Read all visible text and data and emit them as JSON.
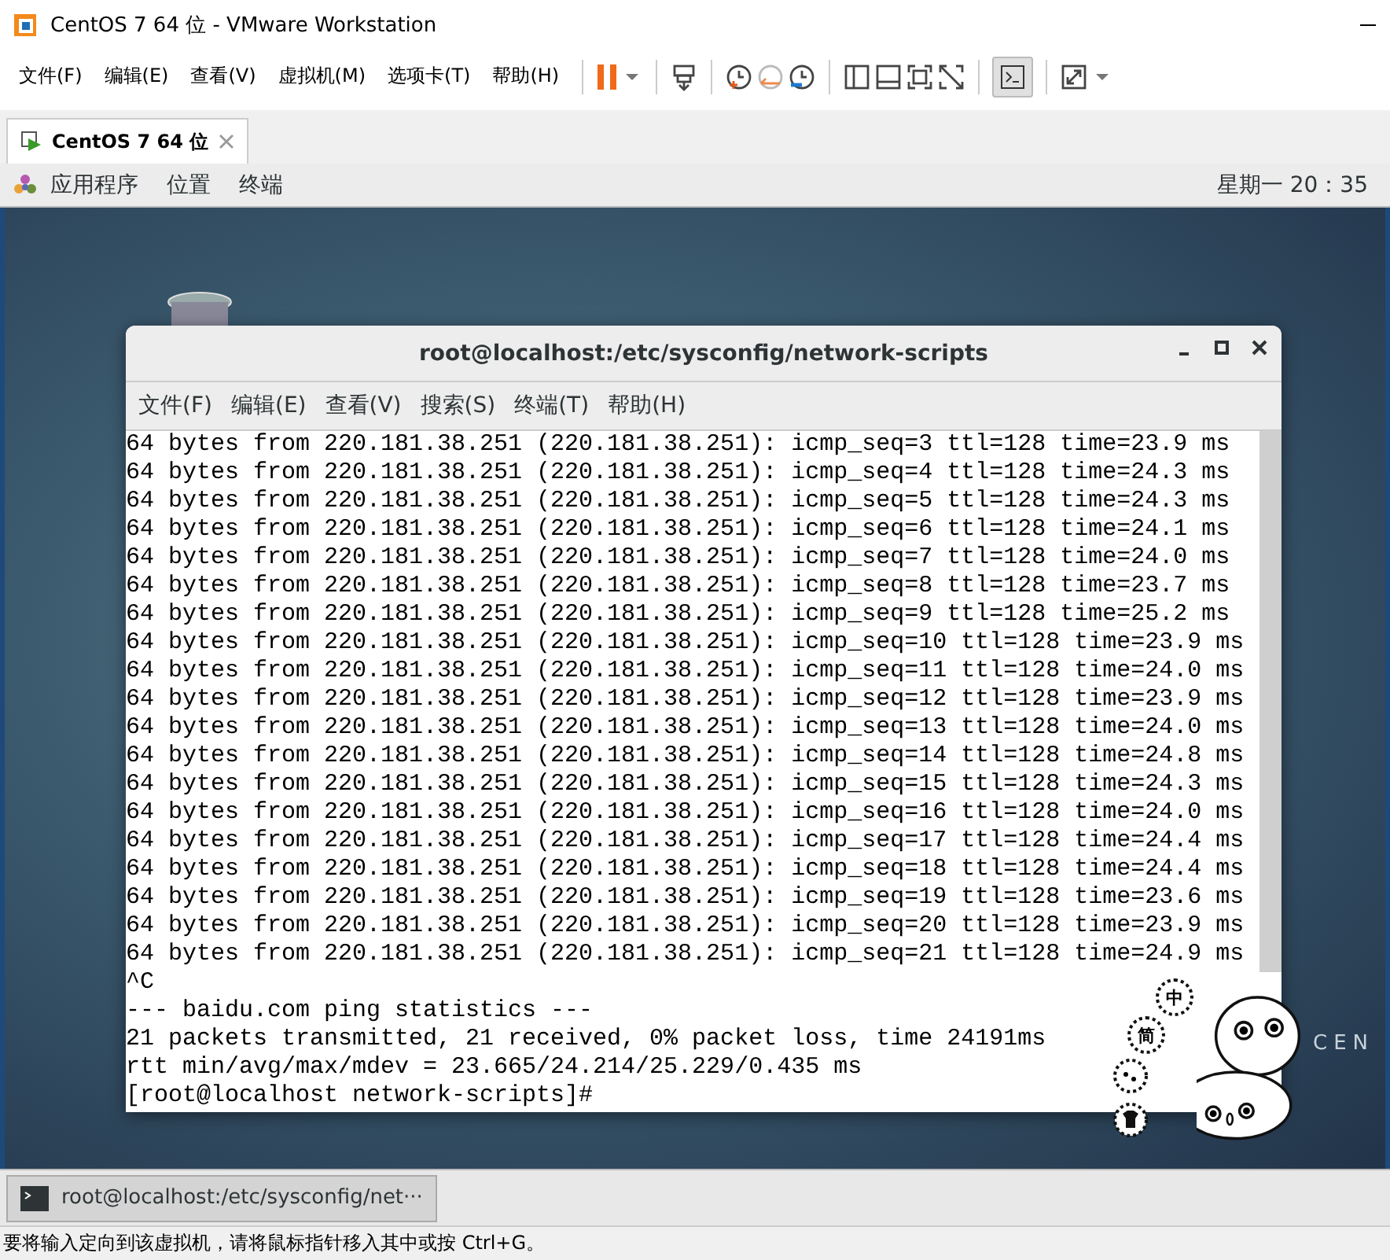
{
  "window": {
    "title": "CentOS 7 64 位 - VMware Workstation"
  },
  "menu": [
    "文件(F)",
    "编辑(E)",
    "查看(V)",
    "虚拟机(M)",
    "选项卡(T)",
    "帮助(H)"
  ],
  "tabs": [
    {
      "label": "CentOS 7 64 位",
      "selected": true
    }
  ],
  "gnome_bar": {
    "items": [
      "应用程序",
      "位置",
      "终端"
    ],
    "clock": "星期一 20：35"
  },
  "desktop": {
    "logo_text": "CEN"
  },
  "terminal": {
    "title": "root@localhost:/etc/sysconfig/network-scripts",
    "menu": [
      "文件(F)",
      "编辑(E)",
      "查看(V)",
      "搜索(S)",
      "终端(T)",
      "帮助(H)"
    ],
    "lines": [
      "64 bytes from 220.181.38.251 (220.181.38.251): icmp_seq=3 ttl=128 time=23.9 ms",
      "64 bytes from 220.181.38.251 (220.181.38.251): icmp_seq=4 ttl=128 time=24.3 ms",
      "64 bytes from 220.181.38.251 (220.181.38.251): icmp_seq=5 ttl=128 time=24.3 ms",
      "64 bytes from 220.181.38.251 (220.181.38.251): icmp_seq=6 ttl=128 time=24.1 ms",
      "64 bytes from 220.181.38.251 (220.181.38.251): icmp_seq=7 ttl=128 time=24.0 ms",
      "64 bytes from 220.181.38.251 (220.181.38.251): icmp_seq=8 ttl=128 time=23.7 ms",
      "64 bytes from 220.181.38.251 (220.181.38.251): icmp_seq=9 ttl=128 time=25.2 ms",
      "64 bytes from 220.181.38.251 (220.181.38.251): icmp_seq=10 ttl=128 time=23.9 ms",
      "64 bytes from 220.181.38.251 (220.181.38.251): icmp_seq=11 ttl=128 time=24.0 ms",
      "64 bytes from 220.181.38.251 (220.181.38.251): icmp_seq=12 ttl=128 time=23.9 ms",
      "64 bytes from 220.181.38.251 (220.181.38.251): icmp_seq=13 ttl=128 time=24.0 ms",
      "64 bytes from 220.181.38.251 (220.181.38.251): icmp_seq=14 ttl=128 time=24.8 ms",
      "64 bytes from 220.181.38.251 (220.181.38.251): icmp_seq=15 ttl=128 time=24.3 ms",
      "64 bytes from 220.181.38.251 (220.181.38.251): icmp_seq=16 ttl=128 time=24.0 ms",
      "64 bytes from 220.181.38.251 (220.181.38.251): icmp_seq=17 ttl=128 time=24.4 ms",
      "64 bytes from 220.181.38.251 (220.181.38.251): icmp_seq=18 ttl=128 time=24.4 ms",
      "64 bytes from 220.181.38.251 (220.181.38.251): icmp_seq=19 ttl=128 time=23.6 ms",
      "64 bytes from 220.181.38.251 (220.181.38.251): icmp_seq=20 ttl=128 time=23.9 ms",
      "64 bytes from 220.181.38.251 (220.181.38.251): icmp_seq=21 ttl=128 time=24.9 ms",
      "^C",
      "--- baidu.com ping statistics ---",
      "21 packets transmitted, 21 received, 0% packet loss, time 24191ms",
      "rtt min/avg/max/mdev = 23.665/24.214/25.229/0.435 ms",
      "[root@localhost network-scripts]#"
    ]
  },
  "ime": {
    "buttons": [
      "中",
      "简"
    ]
  },
  "taskbar": {
    "items": [
      {
        "label": "root@localhost:/etc/sysconfig/net···",
        "selected": true
      }
    ]
  },
  "status_bar": "要将输入定向到该虚拟机，请将鼠标指针移入其中或按 Ctrl+G。"
}
